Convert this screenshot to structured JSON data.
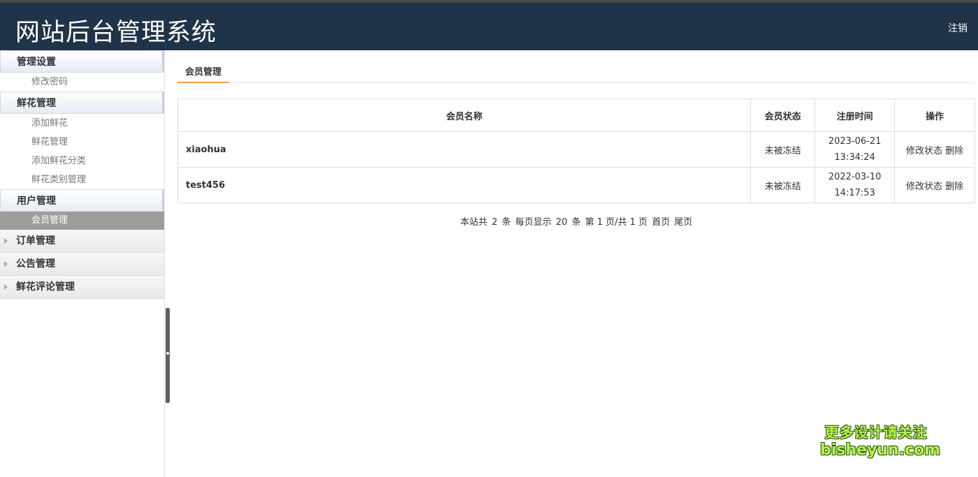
{
  "header": {
    "title": "网站后台管理系统",
    "logout_label": "注销"
  },
  "sidebar": {
    "groups": [
      {
        "label": "管理设置",
        "items": [
          "修改密码"
        ]
      },
      {
        "label": "鲜花管理",
        "items": [
          "添加鲜花",
          "鲜花管理",
          "添加鲜花分类",
          "鲜花类别管理"
        ]
      },
      {
        "label": "用户管理",
        "items": [
          "会员管理"
        ]
      }
    ],
    "collapsed": [
      "订单管理",
      "公告管理",
      "鲜花评论管理"
    ],
    "active_item": "会员管理"
  },
  "main": {
    "tab_label": "会员管理",
    "table": {
      "headers": [
        "会员名称",
        "会员状态",
        "注册时间",
        "操作"
      ],
      "rows": [
        {
          "name": "xiaohua",
          "status": "未被冻结",
          "date": "2023-06-21",
          "time": "13:34:24",
          "op_edit": "修改状态",
          "op_delete": "删除"
        },
        {
          "name": "test456",
          "status": "未被冻结",
          "date": "2022-03-10",
          "time": "14:17:53",
          "op_edit": "修改状态",
          "op_delete": "删除"
        }
      ]
    },
    "pager": {
      "total_prefix": "本站共",
      "total": "2",
      "total_unit": "条",
      "per_page_prefix": "每页显示",
      "per_page": "20",
      "per_page_unit": "条",
      "page_text": "第 1 页/共 1 页",
      "first_label": "首页",
      "last_label": "尾页"
    }
  },
  "watermark": {
    "line1": "更多设计请关注",
    "line2": "bisheyun.com"
  },
  "colors": {
    "header_bg": "#1f3349",
    "status_text": "#c0302a",
    "tab_underline": "#f0a040",
    "active_item_bg": "#9d9d9d"
  }
}
